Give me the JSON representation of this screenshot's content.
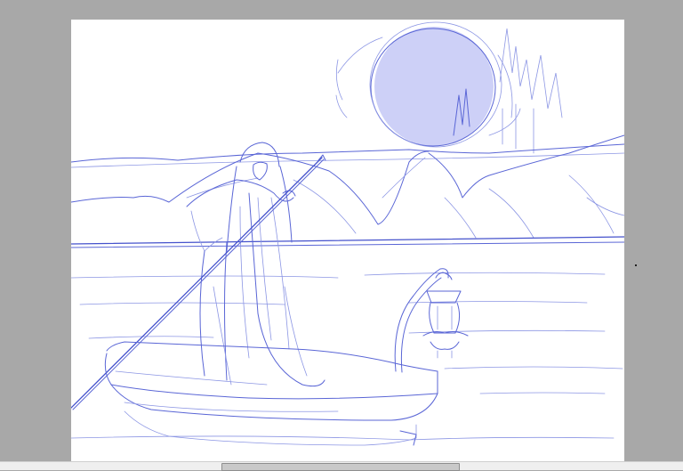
{
  "canvas": {
    "background": "#a8a8a8",
    "page_color": "#ffffff",
    "sketch_color": "#5a66d6",
    "moon_fill": "#cdd0f7"
  },
  "scrollbar": {
    "position": 0.35
  },
  "icons": {
    "scroll_thumb": "scrollbar-thumb"
  }
}
